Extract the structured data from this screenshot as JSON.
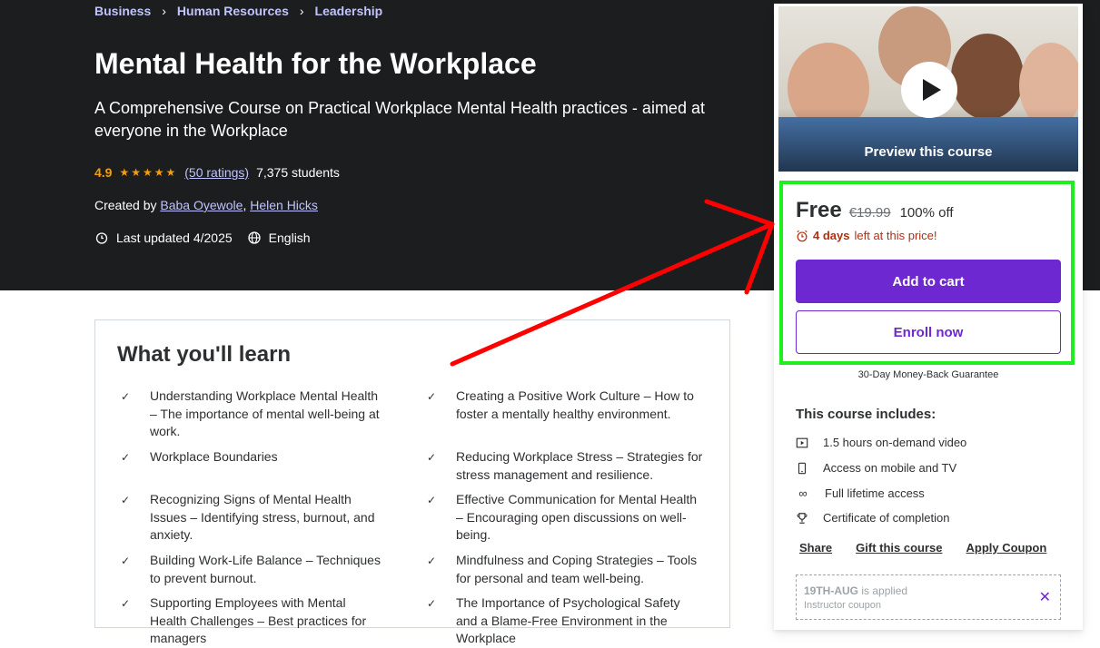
{
  "breadcrumb": [
    "Business",
    "Human Resources",
    "Leadership"
  ],
  "course": {
    "title": "Mental Health for the Workplace",
    "subtitle": "A Comprehensive Course on Practical Workplace Mental Health practices - aimed at everyone in the Workplace",
    "rating": "4.9",
    "rating_value": 4.9,
    "ratings_count": "(50 ratings)",
    "students": "7,375 students",
    "created_by_label": "Created by",
    "instructors": [
      "Baba Oyewole",
      "Helen Hicks"
    ],
    "last_updated": "Last updated 4/2025",
    "language": "English"
  },
  "learn": {
    "title": "What you'll learn",
    "left": [
      "Understanding Workplace Mental Health – The importance of mental well-being at work.",
      "Workplace Boundaries",
      "Recognizing Signs of Mental Health Issues – Identifying stress, burnout, and anxiety.",
      "Building Work-Life Balance – Techniques to prevent burnout.",
      "Supporting Employees with Mental Health Challenges – Best practices for managers"
    ],
    "right": [
      "Creating a Positive Work Culture – How to foster a mentally healthy environment.",
      "Reducing Workplace Stress – Strategies for stress management and resilience.",
      "Effective Communication for Mental Health – Encouraging open discussions on well-being.",
      "Mindfulness and Coping Strategies – Tools for personal and team well-being.",
      "The Importance of Psychological Safety and a Blame-Free Environment in the Workplace"
    ]
  },
  "sidebar": {
    "preview_label": "Preview this course",
    "price": "Free",
    "original_price": "€19.99",
    "discount": "100% off",
    "timer_bold": "4 days",
    "timer_rest": "left at this price!",
    "add_to_cart": "Add to cart",
    "enroll_now": "Enroll now",
    "guarantee": "30-Day Money-Back Guarantee",
    "includes_title": "This course includes:",
    "includes": [
      {
        "icon": "video-icon",
        "label": "1.5 hours on-demand video"
      },
      {
        "icon": "mobile-icon",
        "label": "Access on mobile and TV"
      },
      {
        "icon": "infinity-icon",
        "label": "Full lifetime access"
      },
      {
        "icon": "trophy-icon",
        "label": "Certificate of completion"
      }
    ],
    "links": [
      "Share",
      "Gift this course",
      "Apply Coupon"
    ],
    "coupon_code": "19TH-AUG",
    "coupon_applied": "is applied",
    "coupon_kind": "Instructor coupon"
  },
  "colors": {
    "hero_bg": "#1c1d1f",
    "accent_purple": "#6d28d2",
    "rating_orange": "#f69c08",
    "link_lavender": "#c0c4fc",
    "highlight_green": "#1fef1f",
    "annotation_red": "#ff0000"
  }
}
